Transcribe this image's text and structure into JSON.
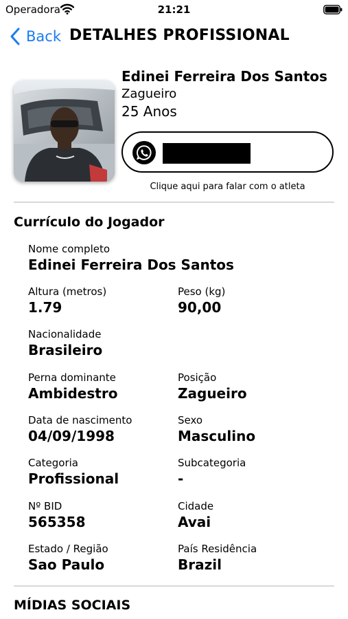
{
  "status_bar": {
    "carrier": "Operadora",
    "time": "21:21"
  },
  "nav": {
    "back_label": "Back",
    "title": "DETALHES PROFISSIONAL"
  },
  "profile": {
    "name": "Edinei Ferreira Dos Santos",
    "position": "Zagueiro",
    "age": "25 Anos",
    "contact_caption": "Clique aqui para falar com o atleta"
  },
  "curriculum": {
    "title": "Currículo do Jogador",
    "fields": {
      "full_name": {
        "label": "Nome completo",
        "value": "Edinei Ferreira Dos Santos"
      },
      "height": {
        "label": "Altura (metros)",
        "value": "1.79"
      },
      "weight": {
        "label": "Peso (kg)",
        "value": "90,00"
      },
      "nationality": {
        "label": "Nacionalidade",
        "value": "Brasileiro"
      },
      "dominant_leg": {
        "label": "Perna dominante",
        "value": "Ambidestro"
      },
      "position": {
        "label": "Posição",
        "value": "Zagueiro"
      },
      "birth_date": {
        "label": "Data de nascimento",
        "value": "04/09/1998"
      },
      "sex": {
        "label": "Sexo",
        "value": "Masculino"
      },
      "category": {
        "label": "Categoria",
        "value": "Profissional"
      },
      "subcategory": {
        "label": "Subcategoria",
        "value": "-"
      },
      "bid": {
        "label": "Nº BID",
        "value": "565358"
      },
      "city": {
        "label": "Cidade",
        "value": "Avai"
      },
      "state": {
        "label": "Estado / Região",
        "value": "Sao Paulo"
      },
      "country": {
        "label": "País Residência",
        "value": "Brazil"
      }
    }
  },
  "social": {
    "title": "MÍDIAS SOCIAIS"
  },
  "colors": {
    "accent": "#1a7cf0",
    "divider": "#d8d8d8",
    "text": "#000000"
  }
}
